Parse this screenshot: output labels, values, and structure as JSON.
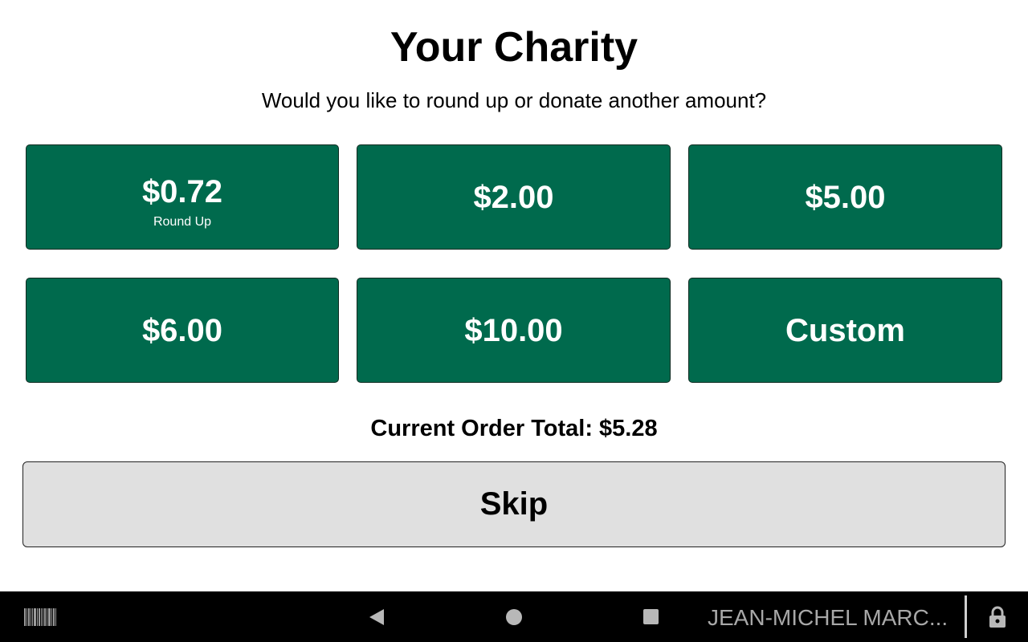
{
  "header": {
    "title": "Your Charity",
    "subtitle": "Would you like to round up or donate another amount?"
  },
  "amounts": [
    {
      "label": "$0.72",
      "sublabel": "Round Up"
    },
    {
      "label": "$2.00"
    },
    {
      "label": "$5.00"
    },
    {
      "label": "$6.00"
    },
    {
      "label": "$10.00"
    },
    {
      "label": "Custom"
    }
  ],
  "order_total": "Current Order Total: $5.28",
  "skip_label": "Skip",
  "navbar": {
    "user_name": "JEAN-MICHEL MARC...",
    "icons": [
      "barcode-icon",
      "back-icon",
      "home-icon",
      "recents-icon",
      "lock-icon"
    ]
  },
  "colors": {
    "button_green": "#006a4d",
    "skip_gray": "#e0e0e0",
    "navbar": "#000000"
  }
}
